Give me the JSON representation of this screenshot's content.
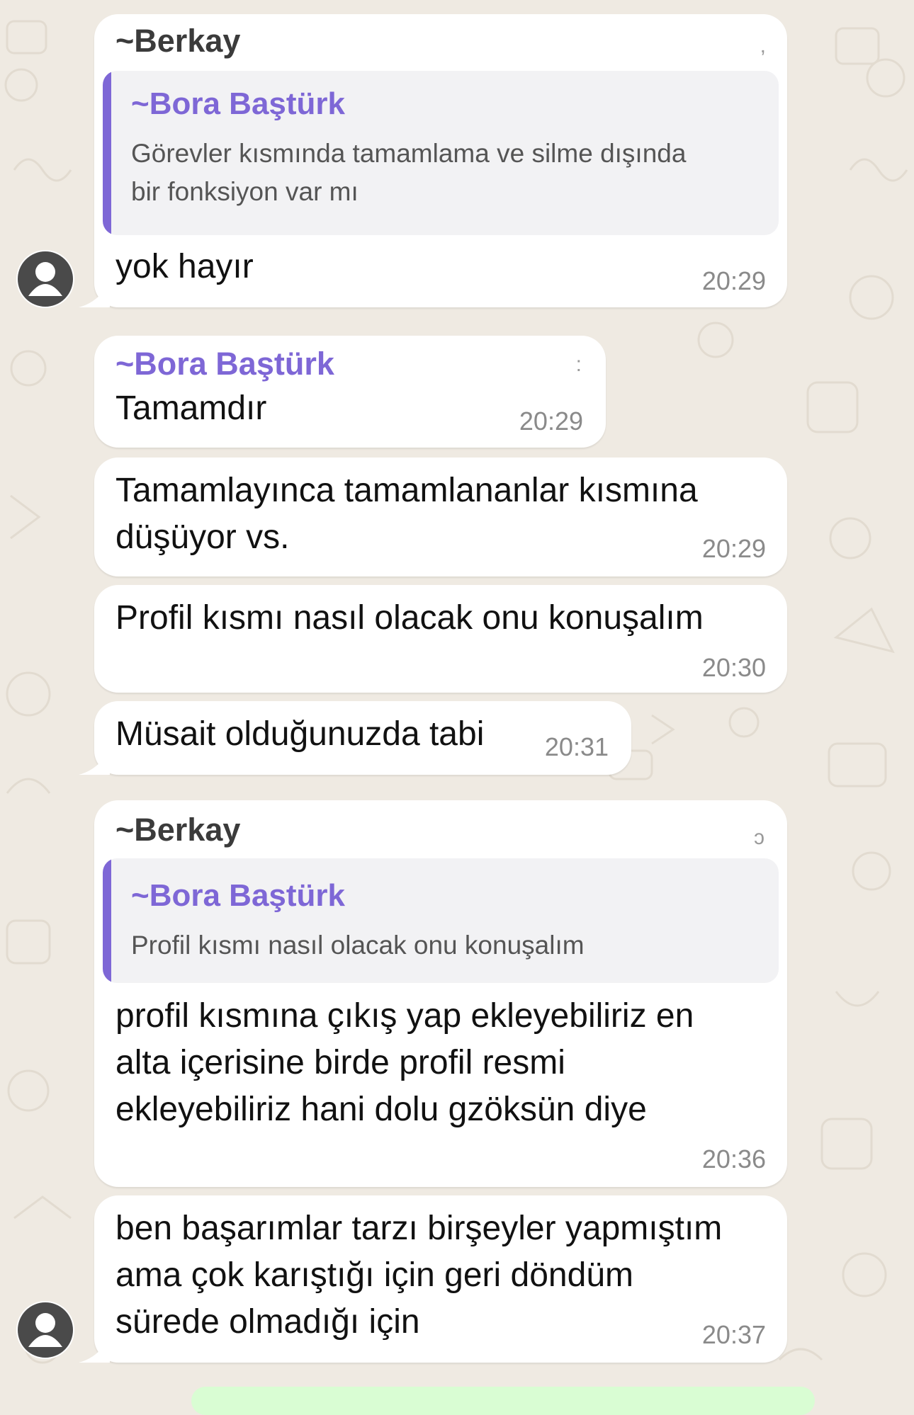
{
  "colors": {
    "wallpaper": "#efeae2",
    "bubble": "#ffffff",
    "sender_purple": "#7e67d6",
    "quote_background": "#f2f2f4",
    "timestamp": "#8a8a8a",
    "outgoing_bubble": "#d9fdd3"
  },
  "messages": [
    {
      "sender": "Berkay",
      "quote": {
        "sender": "Bora Baştürk",
        "text": "Görevler kısmında tamamlama ve silme dışında\nbir fonksiyon var mı"
      },
      "text": "yok hayır",
      "time": "20:29"
    },
    {
      "sender": "Bora Baştürk",
      "text": "Tamamdır",
      "time": "20:29"
    },
    {
      "text": "Tamamlayınca tamamlananlar kısmına\ndüşüyor vs.",
      "time": "20:29"
    },
    {
      "text": "Profil kısmı nasıl olacak onu konuşalım",
      "time": "20:30"
    },
    {
      "text": "Müsait olduğunuzda tabi",
      "time": "20:31"
    },
    {
      "sender": "Berkay",
      "quote": {
        "sender": "Bora Baştürk",
        "text": "Profil kısmı nasıl olacak onu konuşalım"
      },
      "text": "profil kısmına çıkış yap ekleyebiliriz en\nalta içerisine birde profil resmi\nekleyebiliriz hani dolu gzöksün diye",
      "time": "20:36"
    },
    {
      "text": "ben başarımlar tarzı birşeyler yapmıştım\nama çok karıştığı için geri döndüm\nsürede olmadığı için",
      "time": "20:37"
    }
  ],
  "icons": {
    "avatar": "default-avatar-icon",
    "tilde": "~"
  }
}
